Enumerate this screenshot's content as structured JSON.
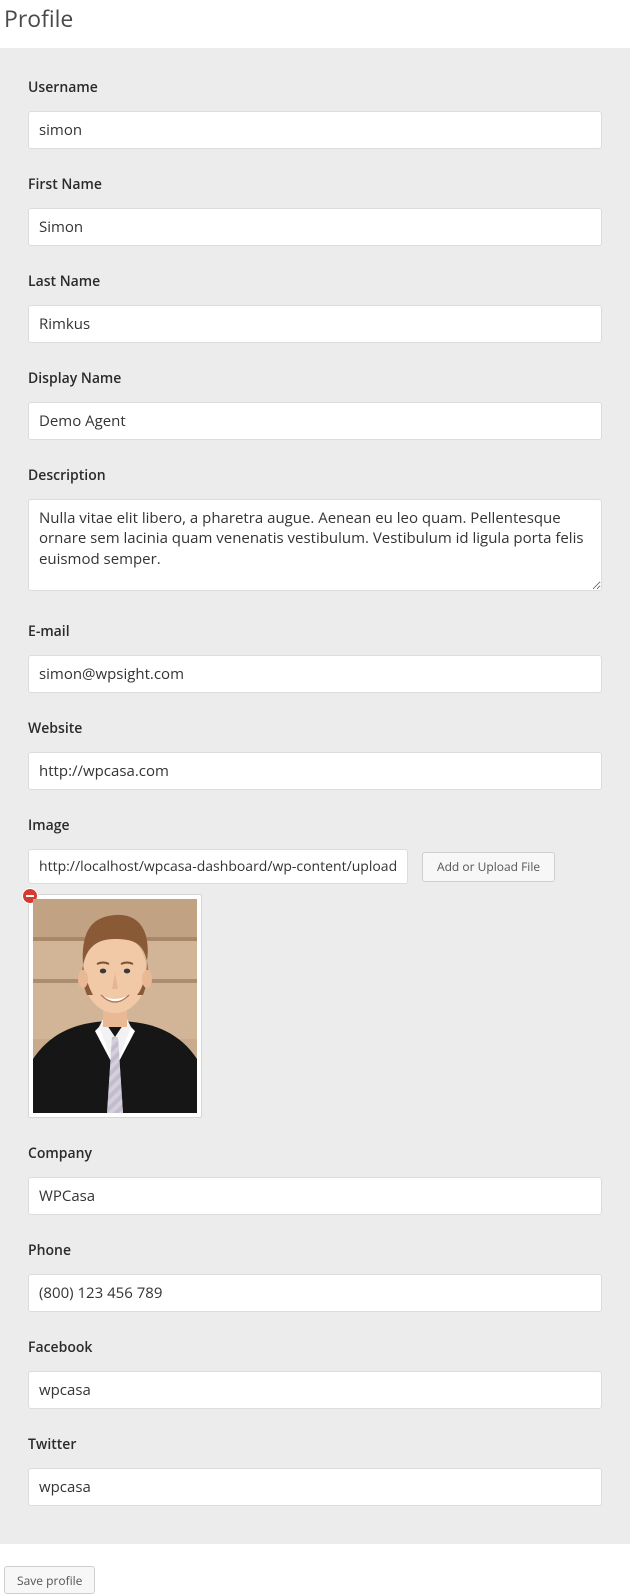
{
  "page": {
    "title": "Profile"
  },
  "fields": {
    "username": {
      "label": "Username",
      "value": "simon"
    },
    "first_name": {
      "label": "First Name",
      "value": "Simon"
    },
    "last_name": {
      "label": "Last Name",
      "value": "Rimkus"
    },
    "display_name": {
      "label": "Display Name",
      "value": "Demo Agent"
    },
    "description": {
      "label": "Description",
      "value": "Nulla vitae elit libero, a pharetra augue. Aenean eu leo quam. Pellentesque ornare sem lacinia quam venenatis vestibulum. Vestibulum id ligula porta felis euismod semper."
    },
    "email": {
      "label": "E-mail",
      "value": "simon@wpsight.com"
    },
    "website": {
      "label": "Website",
      "value": "http://wpcasa.com"
    },
    "image": {
      "label": "Image",
      "value": "http://localhost/wpcasa-dashboard/wp-content/uploads/",
      "upload_button": "Add or Upload File"
    },
    "company": {
      "label": "Company",
      "value": "WPCasa"
    },
    "phone": {
      "label": "Phone",
      "value": "(800) 123 456 789"
    },
    "facebook": {
      "label": "Facebook",
      "value": "wpcasa"
    },
    "twitter": {
      "label": "Twitter",
      "value": "wpcasa"
    }
  },
  "actions": {
    "save": "Save profile"
  }
}
